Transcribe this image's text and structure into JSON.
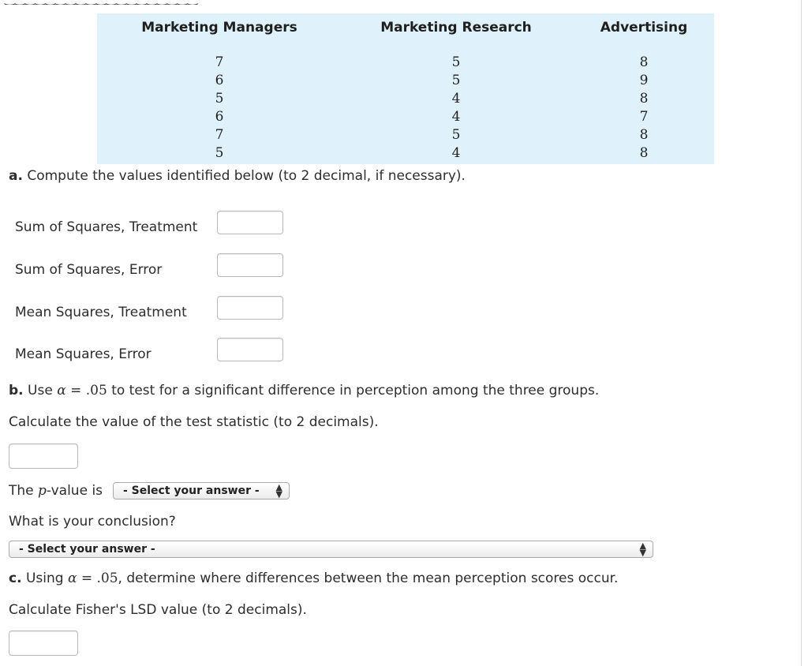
{
  "table": {
    "columns": [
      {
        "header": "Marketing Managers",
        "values": [
          "7",
          "6",
          "5",
          "6",
          "7",
          "5"
        ]
      },
      {
        "header": "Marketing Research",
        "values": [
          "5",
          "5",
          "4",
          "4",
          "5",
          "4"
        ]
      },
      {
        "header": "Advertising",
        "values": [
          "8",
          "9",
          "8",
          "7",
          "8",
          "8"
        ]
      }
    ]
  },
  "part_a": {
    "letter": "a.",
    "text": " Compute the values identified below (to 2 decimal, if necessary).",
    "rows": [
      {
        "label": "Sum of Squares, Treatment",
        "value": ""
      },
      {
        "label": "Sum of Squares, Error",
        "value": ""
      },
      {
        "label": "Mean Squares, Treatment",
        "value": ""
      },
      {
        "label": "Mean Squares, Error",
        "value": ""
      }
    ]
  },
  "part_b": {
    "letter": "b.",
    "use": " Use ",
    "alpha": "α",
    "eq": " = ",
    "alpha_value": ".05",
    "rest": " to test for a significant difference in perception among the three groups.",
    "calc": "Calculate the value of the test statistic (to 2 decimals).",
    "test_statistic_value": "",
    "pvalue_pre": "The ",
    "pvalue_p": "p",
    "pvalue_post": "-value is",
    "pvalue_select": "- Select your answer -",
    "conclusion_q": "What is your conclusion?",
    "conclusion_select": "- Select your answer -"
  },
  "part_c": {
    "letter": "c.",
    "using": " Using ",
    "alpha": "α",
    "eq": " = ",
    "alpha_value": ".05",
    "rest": ", determine where differences between the mean perception scores occur.",
    "calc": "Calculate Fisher's LSD value (to 2 decimals).",
    "lsd_value": ""
  }
}
